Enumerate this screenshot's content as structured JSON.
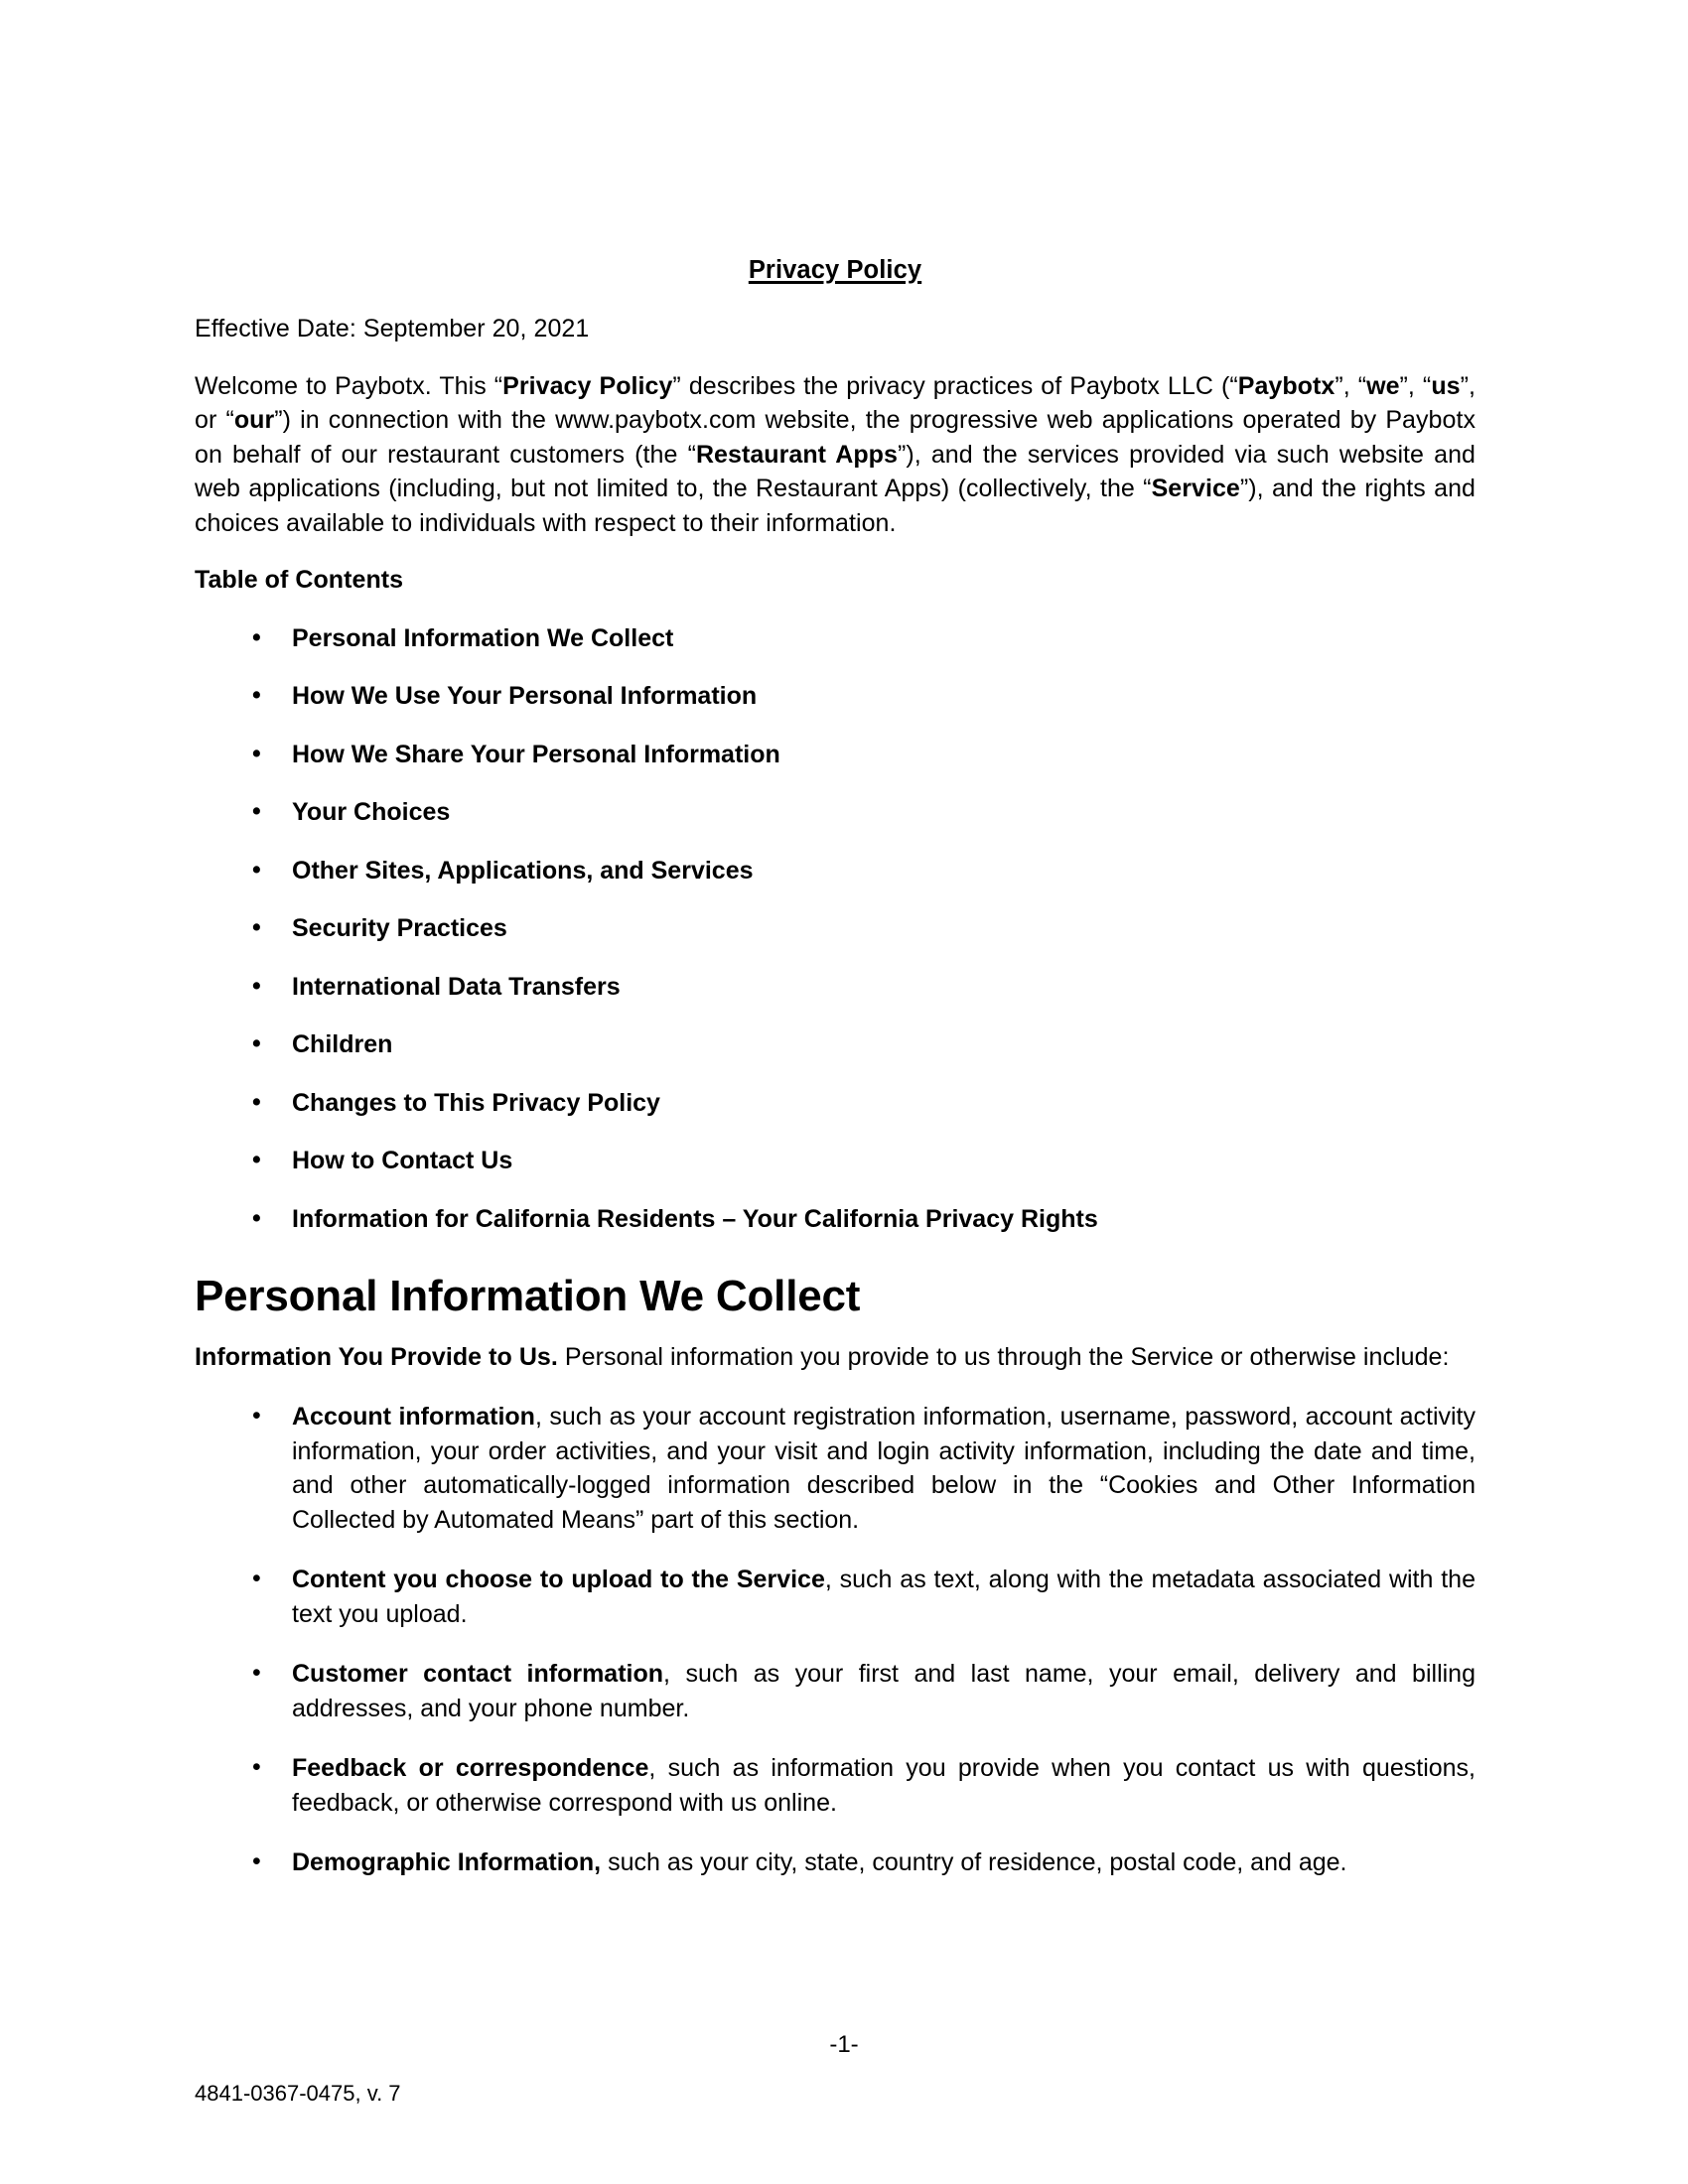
{
  "document": {
    "title": "Privacy Policy",
    "effective_date": "Effective Date: September 20, 2021"
  },
  "intro": {
    "p1_part1": "Welcome to Paybotx. This “",
    "p1_b1": "Privacy Policy",
    "p1_part2": "” describes the privacy practices of Paybotx LLC (“",
    "p1_b2": "Paybotx",
    "p1_part3": "”, “",
    "p1_b3": "we",
    "p1_part4": "”, “",
    "p1_b4": "us",
    "p1_part5": "”, or “",
    "p1_b5": "our",
    "p1_part6": "”) in connection with the www.paybotx.com website, the progressive web applications operated by Paybotx on behalf of our restaurant customers (the “",
    "p1_b6": "Restaurant Apps",
    "p1_part7": "”), and the services provided via such website and web applications (including, but not limited to, the Restaurant Apps) (collectively, the “",
    "p1_b7": "Service",
    "p1_part8": "”), and the rights and choices available to individuals with respect to their information."
  },
  "toc": {
    "heading": "Table of Contents",
    "items": [
      {
        "label": "Personal Information We Collect"
      },
      {
        "label": "How We Use Your Personal Information"
      },
      {
        "label": "How We Share Your Personal Information"
      },
      {
        "label": "Your Choices"
      },
      {
        "label": "Other Sites, Applications, and Services"
      },
      {
        "label": "Security Practices"
      },
      {
        "label": "International Data Transfers"
      },
      {
        "label": "Children"
      },
      {
        "label": "Changes to This Privacy Policy"
      },
      {
        "label": "How to Contact Us"
      },
      {
        "label": "Information for California Residents – Your California Privacy Rights"
      }
    ]
  },
  "section": {
    "heading": "Personal Information We Collect",
    "intro_bold": "Information You Provide to  Us.",
    "intro_rest": " Personal information you provide to us through the Service or otherwise include:",
    "bullets": [
      {
        "lead": "Account information",
        "rest": ", such as your account registration information, username, password, account activity information, your order activities,  and your visit and login activity information, including the date and time, and other automatically-logged information described below in the “Cookies and Other Information Collected by Automated Means” part of this section."
      },
      {
        "lead": "Content you choose to upload to the Service",
        "rest": ", such as text, along with the metadata associated with the text you upload."
      },
      {
        "lead": "Customer contact information",
        "rest": ", such as your first and last name, your email, delivery and billing addresses, and your phone number."
      },
      {
        "lead": "Feedback or correspondence",
        "rest": ", such as information you provide when you contact us with questions, feedback, or otherwise correspond with us online."
      },
      {
        "lead": "Demographic Information,",
        "rest": " such as your city, state, country of residence, postal code, and age."
      }
    ]
  },
  "footer": {
    "page_number": "-1-",
    "doc_reference": "4841-0367-0475, v. 7"
  }
}
